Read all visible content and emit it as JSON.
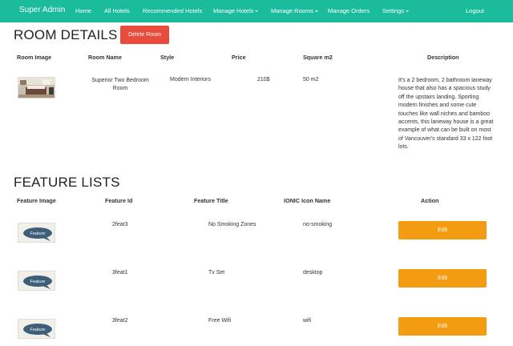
{
  "navbar": {
    "brand": "Super Admin",
    "items": [
      {
        "label": "Home",
        "dropdown": false
      },
      {
        "label": "All Hotels",
        "dropdown": false
      },
      {
        "label": "Recommended Hotels",
        "dropdown": false
      },
      {
        "label": "Manage Hotels",
        "dropdown": true
      },
      {
        "label": "Manage Rooms",
        "dropdown": true
      },
      {
        "label": "Manage Orders",
        "dropdown": false
      },
      {
        "label": "Settings",
        "dropdown": true
      }
    ],
    "logout": "Logout"
  },
  "room_details": {
    "title": "ROOM DETAILS",
    "delete_label": "Delete Room",
    "headers": [
      "Room Image",
      "Room Name",
      "Style",
      "Price",
      "Square m2",
      "Description"
    ],
    "row": {
      "name": "Superior Two Bedroom Room",
      "style": "Modern Interiors",
      "price": "210$",
      "square": "50 m2",
      "description": "It's a 2 bedroom, 2 bathroom laneway house that also has a spacious study off the upstairs landing. Sporting modern finishes and some cute touches like wall niches and bamboo accents, this laneway house is a great example of what can be built on most of Vancouver's standard 33 x 122 foot lots."
    }
  },
  "feature_lists": {
    "title": "FEATURE LISTS",
    "headers": [
      "Feature Image",
      "Feature Id",
      "Feature Title",
      "IONIC Icon Name",
      "Action"
    ],
    "thumb_text": "Feature",
    "edit_label": "Edit",
    "rows": [
      {
        "id": "2feat3",
        "title": "No Smoking Zones",
        "icon": "no-smoking"
      },
      {
        "id": "3feat1",
        "title": "Tv Set",
        "icon": "desktop"
      },
      {
        "id": "3feat2",
        "title": "Free Wifi",
        "icon": "wifi"
      }
    ]
  },
  "colors": {
    "navbar": "#1bbc9b",
    "delete": "#e74c3c",
    "edit": "#f39c12"
  }
}
